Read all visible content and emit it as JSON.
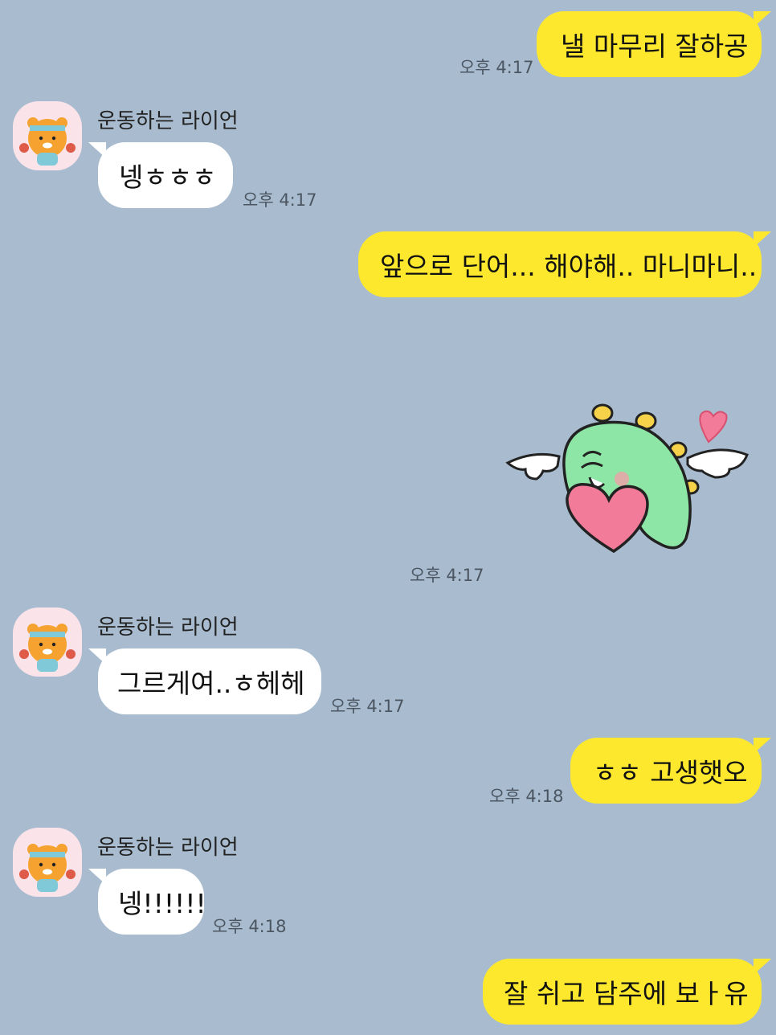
{
  "contact": {
    "name": "운동하는 라이언"
  },
  "messages": [
    {
      "id": "m1",
      "from": "me",
      "text": "낼 마무리 잘하공",
      "time": "오후 4:17"
    },
    {
      "id": "m2",
      "from": "other",
      "text": "넹ㅎㅎㅎ",
      "time": "오후 4:17"
    },
    {
      "id": "m3",
      "from": "me",
      "text": "앞으로 단어... 해야해.. 마니마니..",
      "time": ""
    },
    {
      "id": "m4",
      "from": "me",
      "type": "sticker",
      "sticker": "green-dino-angel-heart-sticker",
      "time": "오후 4:17"
    },
    {
      "id": "m5",
      "from": "other",
      "text": "그르게여..ㅎ헤헤",
      "time": "오후 4:17"
    },
    {
      "id": "m6",
      "from": "me",
      "text": "ㅎㅎ 고생햇오",
      "time": "오후 4:18"
    },
    {
      "id": "m7",
      "from": "other",
      "text": "넹!!!!!!",
      "time": "오후 4:18"
    },
    {
      "id": "m8",
      "from": "me",
      "text": "잘 쉬고 담주에 보ㅏ유",
      "time": ""
    }
  ],
  "colors": {
    "background": "#a9bccf",
    "my_bubble": "#fde82e",
    "their_bubble": "#ffffff",
    "sticker_body": "#8ee6a6",
    "sticker_heart": "#f27b9a"
  }
}
